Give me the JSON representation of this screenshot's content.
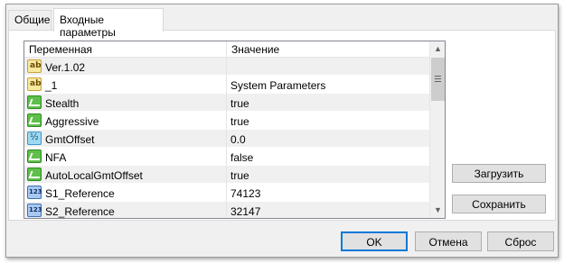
{
  "tabs": [
    {
      "label": "Общие",
      "active": false
    },
    {
      "label": "Входные параметры",
      "active": true
    }
  ],
  "grid": {
    "columns": [
      "Переменная",
      "Значение"
    ],
    "rows": [
      {
        "icon": "ab",
        "name": "Ver.1.02",
        "value": ""
      },
      {
        "icon": "ab",
        "name": "_1",
        "value": "System Parameters"
      },
      {
        "icon": "bool",
        "name": "Stealth",
        "value": "true"
      },
      {
        "icon": "bool",
        "name": "Aggressive",
        "value": "true"
      },
      {
        "icon": "dbl",
        "name": "GmtOffset",
        "value": "0.0"
      },
      {
        "icon": "bool",
        "name": "NFA",
        "value": "false"
      },
      {
        "icon": "bool",
        "name": "AutoLocalGmtOffset",
        "value": "true"
      },
      {
        "icon": "int",
        "name": "S1_Reference",
        "value": "74123"
      },
      {
        "icon": "int",
        "name": "S2_Reference",
        "value": "32147"
      }
    ],
    "scroll_up_glyph": "▲",
    "scroll_down_glyph": "▼"
  },
  "side_buttons": {
    "load": "Загрузить",
    "save": "Сохранить"
  },
  "bottom_buttons": {
    "ok": "OK",
    "cancel": "Отмена",
    "reset": "Сброс"
  },
  "icons": {
    "ab": "string-type-icon",
    "bool": "bool-type-icon",
    "dbl": "double-type-icon",
    "int": "integer-type-icon"
  },
  "colors": {
    "window_bg": "#f0f0f0",
    "ok_focus_border": "#0078d7",
    "row_alt_bg": "#f0f0f0"
  }
}
